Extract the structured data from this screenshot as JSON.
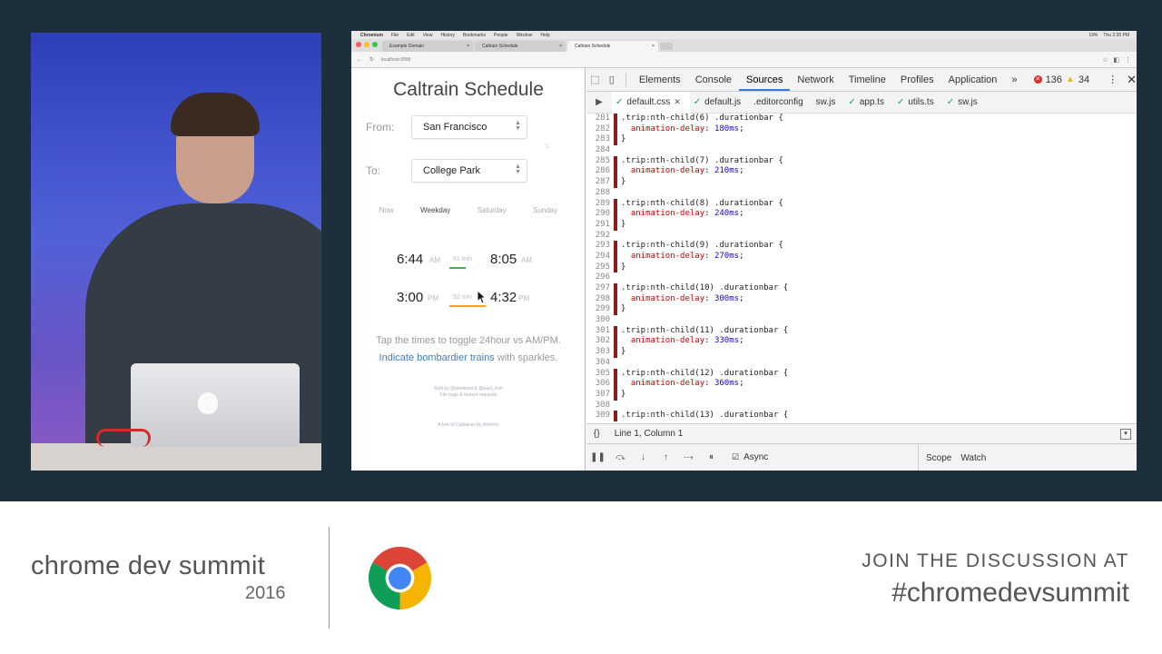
{
  "browser": {
    "menubar": {
      "app": "Chromium",
      "items": [
        "File",
        "Edit",
        "View",
        "History",
        "Bookmarks",
        "People",
        "Window",
        "Help"
      ],
      "battery": "19%",
      "clock": "Thu 2:35 PM"
    },
    "tabs": [
      {
        "title": "Example Domain",
        "active": false
      },
      {
        "title": "Caltrain Schedule",
        "active": false
      },
      {
        "title": "Caltrain Schedule",
        "active": true
      }
    ],
    "url": "localhost:9999"
  },
  "app": {
    "title": "Caltrain Schedule",
    "from_label": "From:",
    "from_value": "San Francisco",
    "to_label": "To:",
    "to_value": "College Park",
    "day_tabs": [
      {
        "label": "Now",
        "active": false
      },
      {
        "label": "Weekday",
        "active": true
      },
      {
        "label": "Saturday",
        "active": false
      },
      {
        "label": "Sunday",
        "active": false
      }
    ],
    "trips": [
      {
        "depart": "6:44",
        "depart_ampm": "AM",
        "duration": "81 min",
        "arrive": "8:05",
        "arrive_ampm": "AM",
        "bar_color": "#3fb34f"
      },
      {
        "depart": "3:00",
        "depart_ampm": "PM",
        "duration": "92 min",
        "arrive": "4:32",
        "arrive_ampm": "PM",
        "bar_color": "#f0a030"
      }
    ],
    "note_line1": "Tap the times to toggle 24hour vs AM/PM.",
    "note_link": "Indicate bombardier trains",
    "note_line2_rest": "with sparkles.",
    "credits_line1": "Built by @aerotwist & @paul_irish",
    "credits_line2": "File bugs & feature requests",
    "credits_line3": "A fork of Caltrainer by Reiminy"
  },
  "devtools": {
    "tabs": [
      {
        "label": "Elements",
        "active": false
      },
      {
        "label": "Console",
        "active": false
      },
      {
        "label": "Sources",
        "active": true
      },
      {
        "label": "Network",
        "active": false
      },
      {
        "label": "Timeline",
        "active": false
      },
      {
        "label": "Profiles",
        "active": false
      },
      {
        "label": "Application",
        "active": false
      }
    ],
    "more": "»",
    "error_count": "136",
    "warning_count": "34",
    "files": [
      {
        "name": "default.css",
        "active": true,
        "check": true,
        "closable": true
      },
      {
        "name": "default.js",
        "active": false,
        "check": true,
        "closable": false
      },
      {
        "name": ".editorconfig",
        "active": false,
        "check": false,
        "closable": false
      },
      {
        "name": "sw.js",
        "active": false,
        "check": false,
        "closable": false
      },
      {
        "name": "app.ts",
        "active": false,
        "check": true,
        "closable": false
      },
      {
        "name": "utils.ts",
        "active": false,
        "check": true,
        "closable": false
      },
      {
        "name": "sw.js",
        "active": false,
        "check": true,
        "closable": false
      }
    ],
    "code": [
      {
        "n": "281",
        "mark": true,
        "kind": "sel",
        "nth": "6"
      },
      {
        "n": "282",
        "mark": true,
        "kind": "prop",
        "val": "180ms"
      },
      {
        "n": "283",
        "mark": true,
        "kind": "close"
      },
      {
        "n": "284",
        "mark": false,
        "kind": "blank"
      },
      {
        "n": "285",
        "mark": true,
        "kind": "sel",
        "nth": "7"
      },
      {
        "n": "286",
        "mark": true,
        "kind": "prop",
        "val": "210ms"
      },
      {
        "n": "287",
        "mark": true,
        "kind": "close"
      },
      {
        "n": "288",
        "mark": false,
        "kind": "blank"
      },
      {
        "n": "289",
        "mark": true,
        "kind": "sel",
        "nth": "8"
      },
      {
        "n": "290",
        "mark": true,
        "kind": "prop",
        "val": "240ms"
      },
      {
        "n": "291",
        "mark": true,
        "kind": "close"
      },
      {
        "n": "292",
        "mark": false,
        "kind": "blank"
      },
      {
        "n": "293",
        "mark": true,
        "kind": "sel",
        "nth": "9"
      },
      {
        "n": "294",
        "mark": true,
        "kind": "prop",
        "val": "270ms"
      },
      {
        "n": "295",
        "mark": true,
        "kind": "close"
      },
      {
        "n": "296",
        "mark": false,
        "kind": "blank"
      },
      {
        "n": "297",
        "mark": true,
        "kind": "sel",
        "nth": "10"
      },
      {
        "n": "298",
        "mark": true,
        "kind": "prop",
        "val": "300ms"
      },
      {
        "n": "299",
        "mark": true,
        "kind": "close"
      },
      {
        "n": "300",
        "mark": false,
        "kind": "blank"
      },
      {
        "n": "301",
        "mark": true,
        "kind": "sel",
        "nth": "11"
      },
      {
        "n": "302",
        "mark": true,
        "kind": "prop",
        "val": "330ms"
      },
      {
        "n": "303",
        "mark": true,
        "kind": "close"
      },
      {
        "n": "304",
        "mark": false,
        "kind": "blank"
      },
      {
        "n": "305",
        "mark": true,
        "kind": "sel",
        "nth": "12"
      },
      {
        "n": "306",
        "mark": true,
        "kind": "prop",
        "val": "360ms"
      },
      {
        "n": "307",
        "mark": true,
        "kind": "close"
      },
      {
        "n": "308",
        "mark": false,
        "kind": "blank"
      },
      {
        "n": "309",
        "mark": true,
        "kind": "sel",
        "nth": "13"
      }
    ],
    "code_strings": {
      "sel_prefix": ".trip:nth-child(",
      "sel_suffix": ") .durationbar {",
      "prop_name": "animation-delay",
      "close": "}"
    },
    "status_braces": "{}",
    "cursor_position": "Line 1, Column 1",
    "async_label": "Async",
    "scope_label": "Scope",
    "watch_label": "Watch"
  },
  "banner": {
    "brand": "chrome dev summit",
    "year": "2016",
    "join": "JOIN THE DISCUSSION AT",
    "hashtag": "#chromedevsummit"
  },
  "colors": {
    "link": "#3a7bd5",
    "active_tab_underline": "#3879d9",
    "error": "#d82b2b",
    "warning": "#f2b21c",
    "gutter_mark": "#8c1c1c"
  },
  "icons": [
    "inspect-icon",
    "device-icon",
    "error-icon",
    "warning-icon",
    "kebab-icon",
    "close-icon",
    "navigator-toggle-icon",
    "pause-icon",
    "step-over-icon",
    "step-into-icon",
    "step-out-icon",
    "deactivate-breakpoints-icon",
    "pause-on-exceptions-icon",
    "swap-icon",
    "chrome-logo"
  ]
}
